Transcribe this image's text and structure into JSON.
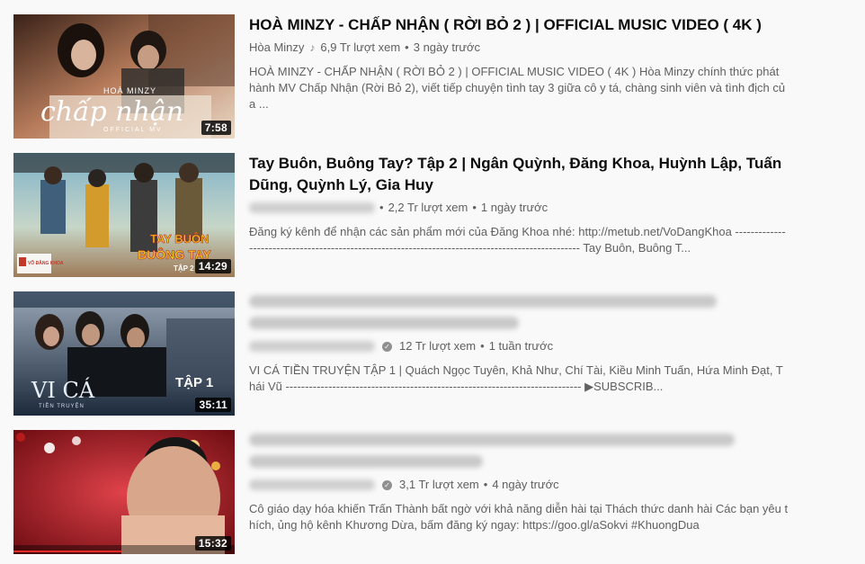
{
  "videos": [
    {
      "title": "HOÀ MINZY - CHẤP NHẬN ( RỜI BỎ 2 ) | OFFICIAL MUSIC VIDEO ( 4K )",
      "channel": "Hòa Minzy",
      "channel_icon": "music-note-icon",
      "views": "6,9 Tr lượt xem",
      "age": "3 ngày trước",
      "duration": "7:58",
      "thumb_text_script": "chấp nhận",
      "thumb_text_top": "HOÀ MINZY",
      "thumb_text_bottom": "OFFICIAL MV",
      "description": "HOÀ MINZY - CHẤP NHẬN ( RỜI BỎ 2 ) | OFFICIAL MUSIC VIDEO ( 4K ) Hòa Minzy chính thức phát hành MV Chấp Nhận (Rời Bỏ 2), viết tiếp chuyện tình tay 3 giữa cô y tá, chàng sinh viên và tình địch của ..."
    },
    {
      "title": "Tay Buôn, Buông Tay? Tập 2 | Ngân Quỳnh, Đăng Khoa, Huỳnh Lập, Tuấn Dũng, Quỳnh Lý, Gia Huy",
      "channel": "",
      "views": "2,2 Tr lượt xem",
      "age": "1 ngày trước",
      "duration": "14:29",
      "thumb_text_a": "TAY BUÔN",
      "thumb_text_b": "BUÔNG TAY",
      "thumb_text_c": "TẬP 2",
      "thumb_logo": "VÕ ĐĂNG KHOA",
      "description": "Đăng ký kênh để nhận các sản phẩm mới của Đăng Khoa nhé: http://metub.net/VoDangKhoa -------------------------------------------------------------------------------------------------- Tay Buôn, Buông T..."
    },
    {
      "title": "",
      "channel": "",
      "views": "12 Tr lượt xem",
      "age": "1 tuần trước",
      "duration": "35:11",
      "thumb_text_a": "VI CÁ",
      "thumb_text_b": "TIỀN TRUYỆN",
      "thumb_text_c": "TẬP 1",
      "description": "VI CÁ TIỀN TRUYỆN TẬP 1 | Quách Ngọc Tuyên, Khả Như, Chí Tài, Kiều Minh Tuấn, Hứa Minh Đạt, Thái Vũ ---------------------------------------------------------------------------- ▶SUBSCRIB..."
    },
    {
      "title": "",
      "channel": "",
      "views": "3,1 Tr lượt xem",
      "age": "4 ngày trước",
      "duration": "15:32",
      "description": "Cô giáo dạy hóa khiến Trấn Thành bất ngờ với khả năng diễn hài tại Thách thức danh hài Các bạn yêu thích, ủng hộ kênh Khương Dừa, bấm đăng ký ngay: https://goo.gl/aSokvi #KhuongDua"
    }
  ],
  "colors": {
    "background": "#f9f9f9",
    "title": "#0d0d0d",
    "meta": "#606060",
    "duration_bg": "#000000"
  }
}
